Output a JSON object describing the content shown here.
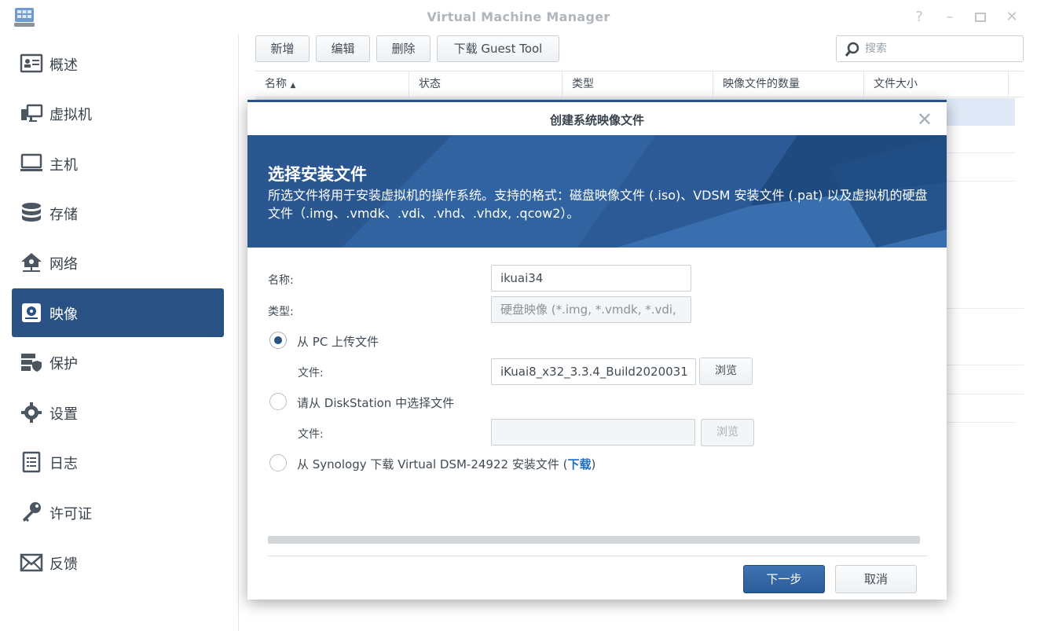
{
  "window": {
    "title": "Virtual Machine Manager",
    "controls": [
      "help-icon",
      "minimize-icon",
      "maximize-icon",
      "close-icon"
    ]
  },
  "sidebar": {
    "items": [
      {
        "label": "概述",
        "icon": "overview-icon"
      },
      {
        "label": "虚拟机",
        "icon": "virtual-machine-icon"
      },
      {
        "label": "主机",
        "icon": "host-icon"
      },
      {
        "label": "存储",
        "icon": "storage-icon"
      },
      {
        "label": "网络",
        "icon": "network-icon"
      },
      {
        "label": "映像",
        "icon": "image-icon",
        "active": true
      },
      {
        "label": "保护",
        "icon": "protection-icon"
      },
      {
        "label": "设置",
        "icon": "settings-icon"
      },
      {
        "label": "日志",
        "icon": "log-icon"
      },
      {
        "label": "许可证",
        "icon": "license-icon"
      },
      {
        "label": "反馈",
        "icon": "feedback-icon"
      }
    ]
  },
  "toolbar": {
    "add": "新增",
    "edit": "编辑",
    "delete": "删除",
    "download_guest_tool": "下载 Guest Tool",
    "search_placeholder": "搜索"
  },
  "grid": {
    "columns": [
      "名称",
      "状态",
      "类型",
      "映像文件的数量",
      "文件大小"
    ],
    "sort_indicator": "▲"
  },
  "dialog": {
    "title": "创建系统映像文件",
    "banner_title": "选择安装文件",
    "banner_desc": "所选文件将用于安装虚拟机的操作系统。支持的格式：磁盘映像文件 (.iso)、VDSM 安装文件 (.pat) 以及虚拟机的硬盘文件（.img、.vmdk、.vdi、.vhd、.vhdx, .qcow2）。",
    "name_label": "名称:",
    "name_value": "ikuai34",
    "type_label": "类型:",
    "type_value": "硬盘映像 (*.img, *.vmdk, *.vdi,",
    "option_pc": "从 PC 上传文件",
    "file_label": "文件:",
    "file_pc_value": "iKuai8_x32_3.3.4_Build2020031",
    "browse": "浏览",
    "option_ds": "请从 DiskStation 中选择文件",
    "file_ds_value": "",
    "option_syn_prefix": "从 Synology 下载 Virtual DSM-24922 安装文件 (",
    "option_syn_link": "下载",
    "option_syn_suffix": ")",
    "next": "下一步",
    "cancel": "取消",
    "accent_color": "#2a5184",
    "banner_color": "#2d5b95"
  }
}
